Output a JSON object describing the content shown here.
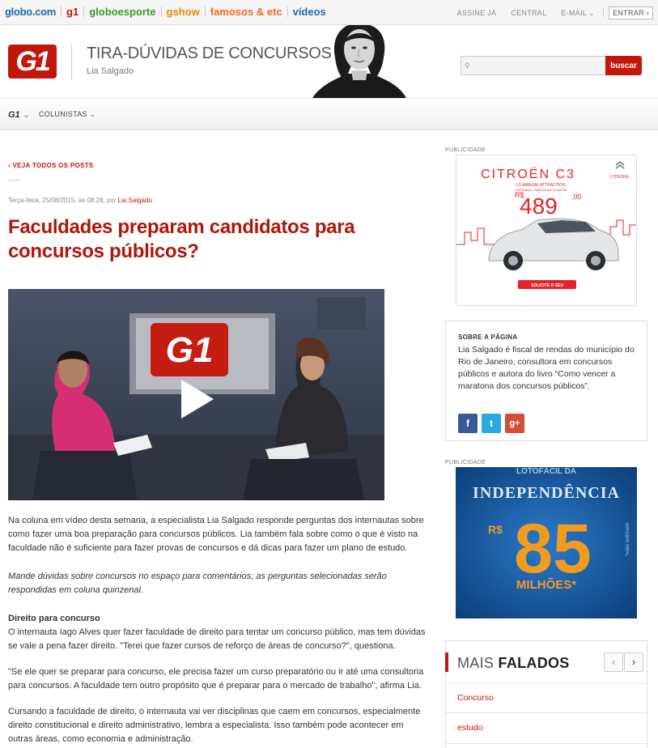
{
  "topbar": {
    "links": [
      {
        "label": "globo.com",
        "color": "#1d6ab7"
      },
      {
        "label": "g1",
        "color": "#c4170c"
      },
      {
        "label": "globoesporte",
        "color": "#3b9a2a"
      },
      {
        "label": "gshow",
        "color": "#f08a00"
      },
      {
        "label": "famosos & etc",
        "color": "#f06b1c"
      },
      {
        "label": "vídeos",
        "color": "#1d6ab7"
      }
    ],
    "right": {
      "assine": "ASSINE JÁ",
      "central": "CENTRAL",
      "email": "E-MAIL",
      "entrar": "ENTRAR"
    }
  },
  "header": {
    "logo": "G1",
    "blog_title": "TIRA-DÚVIDAS DE CONCURSOS",
    "author": "Lia Salgado",
    "search_placeholder": "",
    "search_button": "buscar"
  },
  "subnav": {
    "g1": "G1",
    "colunistas": "COLUNISTAS"
  },
  "post": {
    "back_link": "VEJA TODOS OS POSTS",
    "meta_date": "Terça-feira, 25/08/2015, às 08:28, por ",
    "meta_author": "Lia Salgado",
    "title": "Faculdades preparam candidatos para concursos públicos?",
    "video_logo": "G1",
    "paragraphs": [
      "Na coluna em vídeo desta semana, a especialista Lia Salgado responde perguntas dos internautas sobre como fazer uma boa preparação para concursos públicos. Lia também fala sobre como o que é visto na faculdade não é suficiente para fazer provas de concursos e dá dicas para fazer um plano de estudo.",
      "Mande dúvidas sobre concursos no espaço para comentários; as perguntas selecionadas serão respondidas em coluna quinzenal.",
      "Direito para concurso",
      "O internauta Iago Alves quer fazer faculdade de direito para tentar um concurso público, mas tem dúvidas se vale a pena fazer direito. \"Terei que fazer cursos de reforço de áreas de concurso?\", questiona.",
      "\"Se ele quer se preparar para concurso, ele precisa fazer um curso preparatório ou ir até uma consultoria para concursos. A faculdade tem outro propósito que é preparar para o mercado de trabalho\", afirma Lia.",
      "Cursando a faculdade de direito, o internauta vai ver disciplinas que caem em concursos, especialmente direito constitucional e direito administrativo, lembra a especialista. Isso também pode acontecer em outras áreas, como economia e administração."
    ]
  },
  "sidebar": {
    "publicidade": "PUBLICIDADE",
    "ad1": {
      "brand": "CITROËN C3",
      "line1": "1.5 MANUAL ATTRACTION",
      "line2": "ENTRADA + PARCELAS FIXAS DE",
      "currency": "R$",
      "price": "489",
      "cents": ",00",
      "cta": "SOLICITE O SEU",
      "logo": "CITROËN"
    },
    "sobre": {
      "heading": "SOBRE A PÁGINA",
      "text": "Lia Salgado é fiscal de rendas do município do Rio de Janeiro, consultora em concursos públicos e autora do livro “Como vencer a maratona dos concursos públicos”.",
      "social": [
        {
          "icon": "facebook-icon",
          "glyph": "f",
          "color": "#3b5998"
        },
        {
          "icon": "twitter-icon",
          "glyph": "t",
          "color": "#2aa9e0"
        },
        {
          "icon": "google-plus-icon",
          "glyph": "g+",
          "color": "#d24e36"
        }
      ]
    },
    "ad2": {
      "top": "LOTOFÁCIL DA",
      "title": "INDEPENDÊNCIA",
      "currency": "R$",
      "value": "85",
      "unit": "MILHÕES*",
      "note": "*valor estimado"
    },
    "mais": {
      "light": "MAIS ",
      "bold": "FALADOS",
      "items": [
        "Concurso",
        "estudo"
      ]
    }
  }
}
